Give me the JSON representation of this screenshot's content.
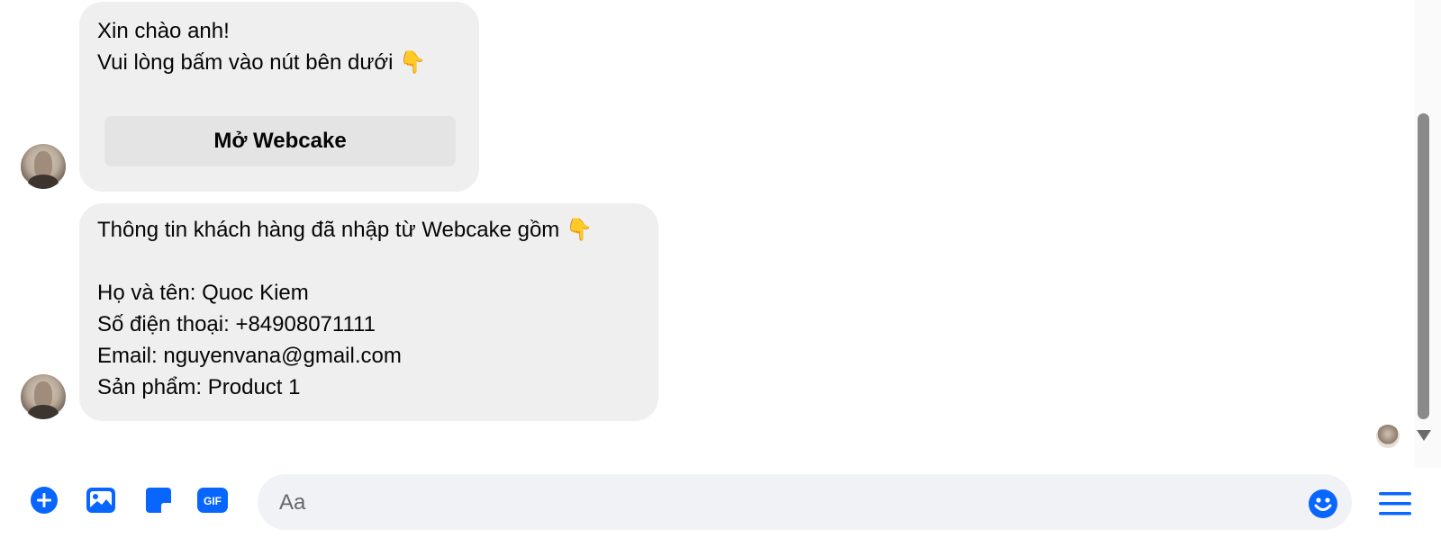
{
  "messages": [
    {
      "lines": [
        "Xin chào anh!",
        "Vui lòng bấm vào nút bên dưới 👇"
      ],
      "button_label": "Mở Webcake"
    },
    {
      "header": "Thông tin khách hàng đã nhập từ Webcake gồm 👇",
      "lines": [
        "Họ và tên: Quoc Kiem",
        "Số điện thoại: +84908071111",
        "Email: nguyenvana@gmail.com",
        "Sản phẩm: Product 1"
      ]
    }
  ],
  "composer": {
    "placeholder": "Aa",
    "icons": [
      "plus-circle-icon",
      "image-icon",
      "sticker-icon",
      "gif-icon",
      "emoji-icon",
      "menu-icon"
    ],
    "gif_label": "GIF"
  },
  "colors": {
    "accent": "#0866ff",
    "bubble": "#efefef"
  }
}
